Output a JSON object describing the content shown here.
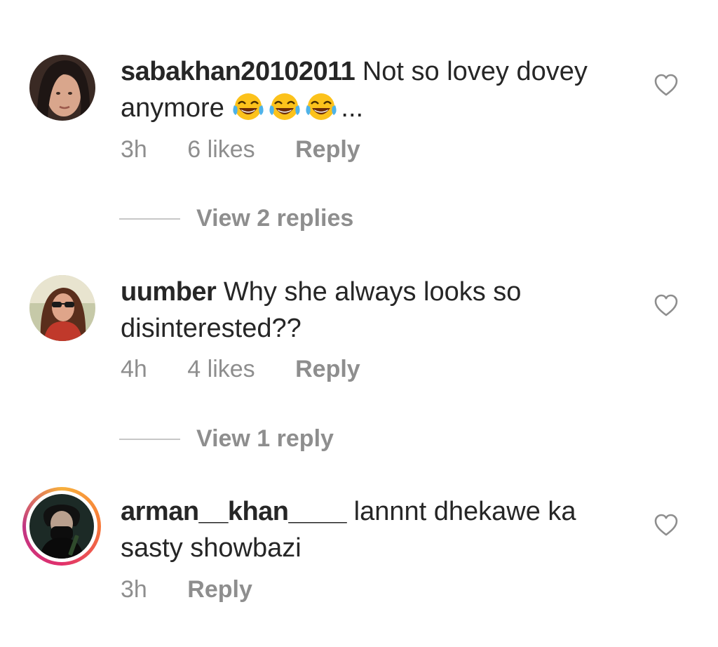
{
  "comments": [
    {
      "username": "sabakhan20102011",
      "text": "Not so lovey dovey anymore",
      "trailing": "...",
      "emojis": [
        "face-with-tears-of-joy",
        "face-with-tears-of-joy",
        "face-with-tears-of-joy"
      ],
      "time": "3h",
      "likes": "6 likes",
      "reply": "Reply",
      "view_replies": "View 2 replies"
    },
    {
      "username": "uumber",
      "text": "Why she always looks so disinterested??",
      "time": "4h",
      "likes": "4 likes",
      "reply": "Reply",
      "view_replies": "View 1 reply"
    },
    {
      "username": "arman__khan____",
      "text": "lannnt dhekawe ka sasty showbazi",
      "time": "3h",
      "reply": "Reply",
      "has_story_ring": true
    }
  ],
  "colors": {
    "text": "#262626",
    "secondary": "#8e8e8e",
    "divider": "#c7c7c7",
    "story_ring": "#e1306c"
  },
  "icons": {
    "like": "heart-outline-icon"
  }
}
